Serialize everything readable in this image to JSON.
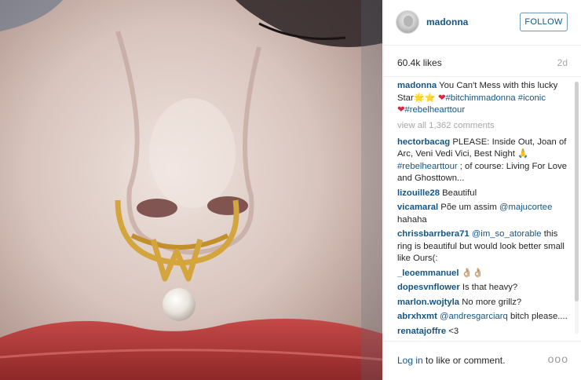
{
  "post": {
    "username": "madonna",
    "follow_label": "FOLLOW",
    "likes": "60.4k likes",
    "age": "2d"
  },
  "caption": {
    "user": "madonna",
    "text_1": "You Can't Mess with this lucky Star",
    "stars": "🌟⭐",
    "heart": "❤",
    "tag_1": "#bitchimmadonna",
    "tag_2": "#iconic",
    "heart_2": "❤",
    "tag_3": "#rebelhearttour"
  },
  "view_all": "view all 1,362 comments",
  "comments": [
    {
      "user": "hectorbacag",
      "text": "PLEASE: Inside Out, Joan of Arc, Veni Vedi Vici, Best Night 🙏",
      "tag": "#rebelhearttour",
      "text_after": " ; of course: Living For Love and Ghosttown..."
    },
    {
      "user": "lizouille28",
      "text": "Beautiful"
    },
    {
      "user": "vicamaral",
      "text": "Põe um assim ",
      "mention": "@majucortee",
      "text_after": " hahaha"
    },
    {
      "user": "chrissbarrbera71",
      "mention": "@im_so_atorable",
      "text_after": " this ring is beautiful but would look better small like Ours(:"
    },
    {
      "user": "_leoemmanuel",
      "text": "👌🏼👌🏼"
    },
    {
      "user": "dopesvnflower",
      "text": "Is that heavy?"
    },
    {
      "user": "marlon.wojtyla",
      "text": "No more grillz?"
    },
    {
      "user": "abrxhxmt",
      "mention": "@andresgarciarq",
      "text_after": " bitch please...."
    },
    {
      "user": "renatajoffre",
      "text": "<3"
    }
  ],
  "footer": {
    "login_link": "Log in",
    "login_text": " to like or comment.",
    "more": "ooo"
  },
  "colors": {
    "link_blue": "#125688",
    "muted": "#a5a7aa",
    "heart": "#e0243f",
    "gold": "#d4a53c",
    "lips": "#b83a3a"
  }
}
